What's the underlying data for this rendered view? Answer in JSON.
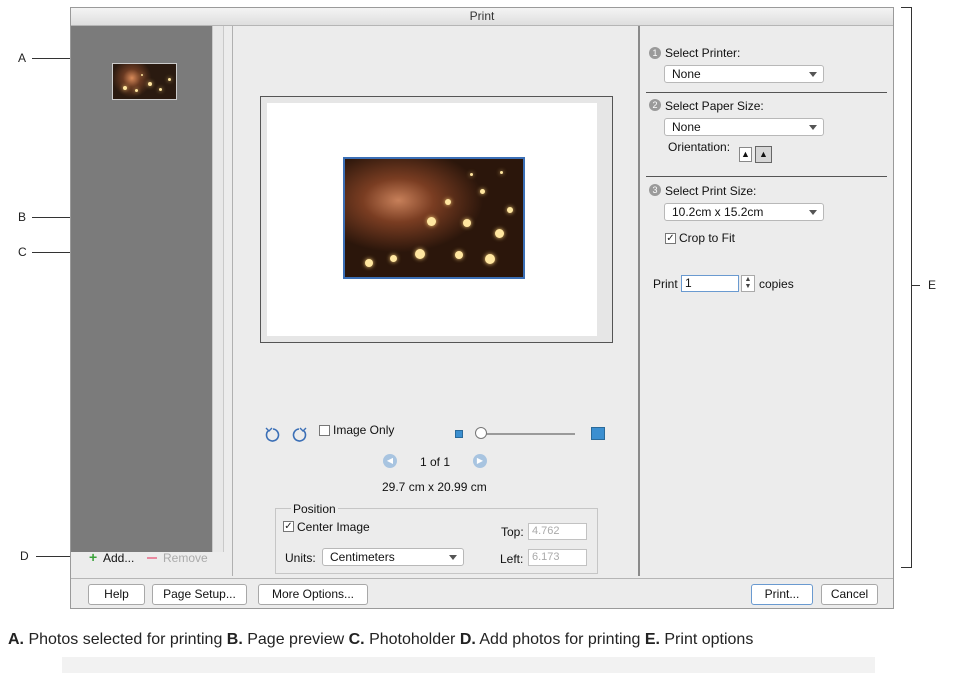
{
  "window": {
    "title": "Print"
  },
  "callouts": {
    "a": "A",
    "b": "B",
    "c": "C",
    "d": "D",
    "e": "E"
  },
  "thumbnails": {
    "add_label": "Add...",
    "remove_label": "Remove"
  },
  "preview": {
    "image_only_label": "Image Only",
    "page_indicator": "1 of 1",
    "page_size": "29.7 cm x 20.99 cm",
    "zoom_level": 0.0
  },
  "position": {
    "legend": "Position",
    "center_image_label": "Center Image",
    "center_image_checked": true,
    "units_label": "Units:",
    "units_value": "Centimeters",
    "top_label": "Top:",
    "top_value": "4.762",
    "left_label": "Left:",
    "left_value": "6.173"
  },
  "options": {
    "step1": "1",
    "step2": "2",
    "step3": "3",
    "select_printer_label": "Select Printer:",
    "printer_value": "None",
    "select_paper_label": "Select Paper Size:",
    "paper_value": "None",
    "orientation_label": "Orientation:",
    "select_print_size_label": "Select Print Size:",
    "print_size_value": "10.2cm x 15.2cm",
    "crop_to_fit_label": "Crop to Fit",
    "crop_to_fit_checked": true,
    "print_label": "Print",
    "copies_value": "1",
    "copies_label": "copies"
  },
  "footer": {
    "help": "Help",
    "page_setup": "Page Setup...",
    "more_options": "More Options...",
    "print": "Print...",
    "cancel": "Cancel"
  },
  "caption": {
    "a_letter": "A.",
    "a_text": " Photos selected for printing ",
    "b_letter": "B.",
    "b_text": " Page preview ",
    "c_letter": "C.",
    "c_text": " Photoholder ",
    "d_letter": "D.",
    "d_text": " Add photos for printing ",
    "e_letter": "E.",
    "e_text": " Print options"
  },
  "colors": {
    "accent_blue": "#3b6fb6",
    "add_green": "#3aa33a",
    "remove_pink": "#e98aa0",
    "thumb_panel": "#7b7b7b",
    "window_bg": "#ececec"
  }
}
